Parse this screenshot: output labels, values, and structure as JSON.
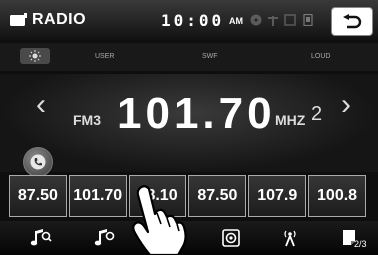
{
  "header": {
    "title": "RADIO",
    "clock": "10:00",
    "ampm": "AM"
  },
  "audio_modes": {
    "user": "USER",
    "swf": "SWF",
    "loud": "LOUD"
  },
  "tuner": {
    "band": "FM3",
    "frequency": "101.70",
    "unit": "MHZ",
    "preset_number": "2"
  },
  "presets": [
    "87.50",
    "101.70",
    "98.10",
    "87.50",
    "107.9",
    "100.8"
  ],
  "footer": {
    "page": "2/3"
  },
  "icons": {
    "radio": "radio-icon",
    "back": "back-arrow-icon",
    "phone": "phone-icon",
    "brightness": "sun-icon",
    "seek_prev": "chevron-left-icon",
    "seek_next": "chevron-right-icon",
    "music_search": "music-note-icon",
    "scan": "scan-icon",
    "antenna": "antenna-icon",
    "page": "page-icon"
  },
  "colors": {
    "background": "#0e0e0e",
    "text": "#ffffff"
  }
}
